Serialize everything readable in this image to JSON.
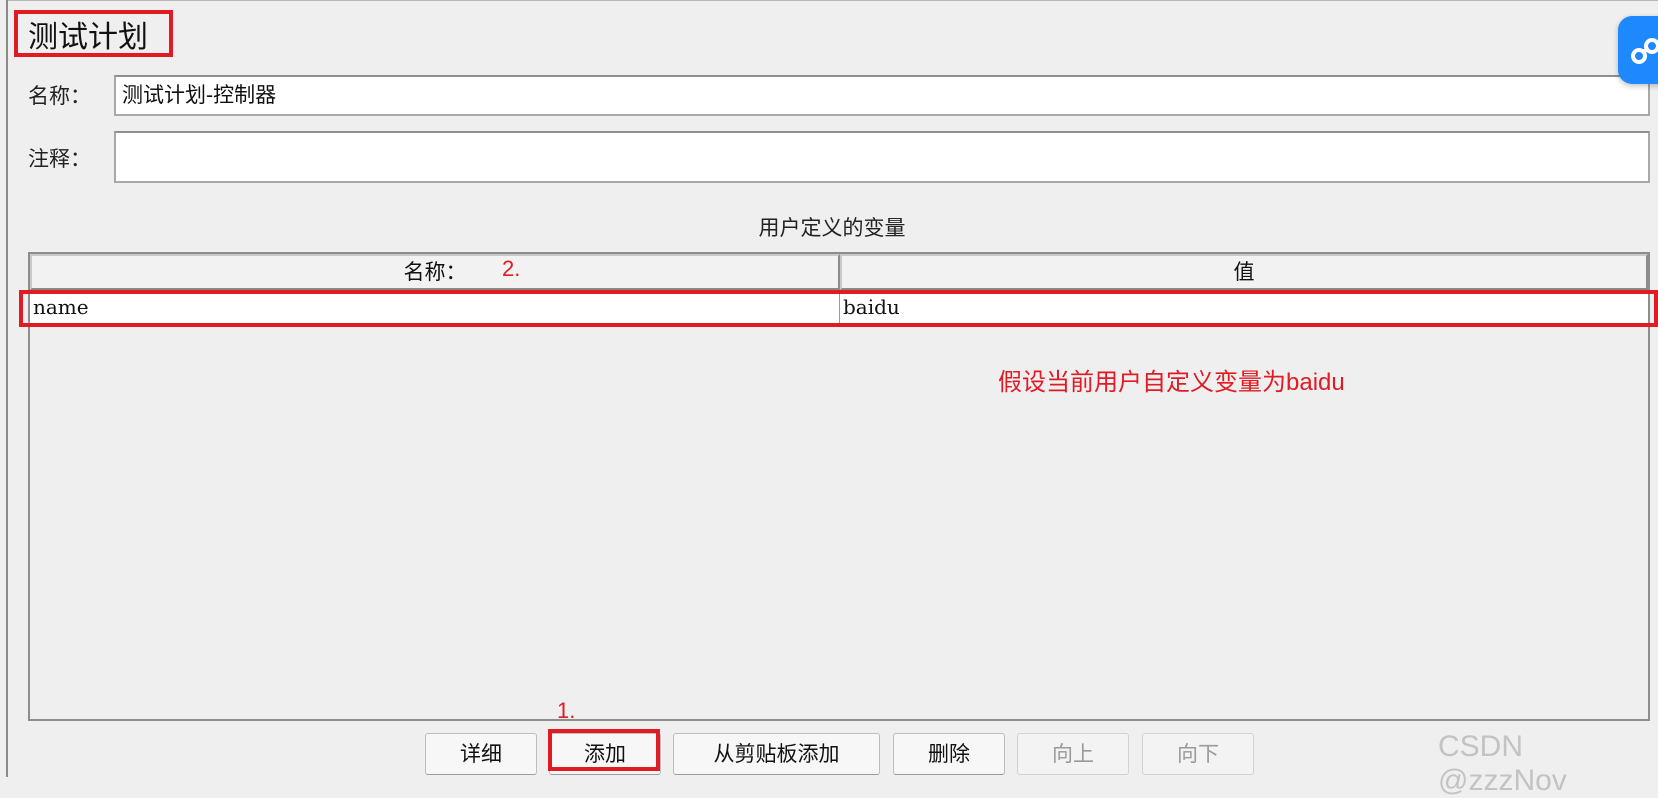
{
  "page": {
    "title": "测试计划"
  },
  "fields": {
    "name_label": "名称：",
    "name_value": "测试计划-控制器",
    "comment_label": "注释：",
    "comment_value": ""
  },
  "variables": {
    "section_title": "用户定义的变量",
    "columns": [
      "名称：",
      "值"
    ],
    "rows": [
      {
        "name": "name",
        "value": "baidu"
      }
    ]
  },
  "buttons": [
    {
      "label": "详细",
      "enabled": true
    },
    {
      "label": "添加",
      "enabled": true
    },
    {
      "label": "从剪贴板添加",
      "enabled": true
    },
    {
      "label": "删除",
      "enabled": true
    },
    {
      "label": "向上",
      "enabled": false
    },
    {
      "label": "向下",
      "enabled": false
    }
  ],
  "annotations": {
    "step1": "1.",
    "step2": "2.",
    "note": "假设当前用户自定义变量为baidu",
    "color": "#e01b23"
  },
  "watermark": "CSDN @zzzNov",
  "floating_button": {
    "icon": "link-icon",
    "color": "#1e88ff"
  }
}
